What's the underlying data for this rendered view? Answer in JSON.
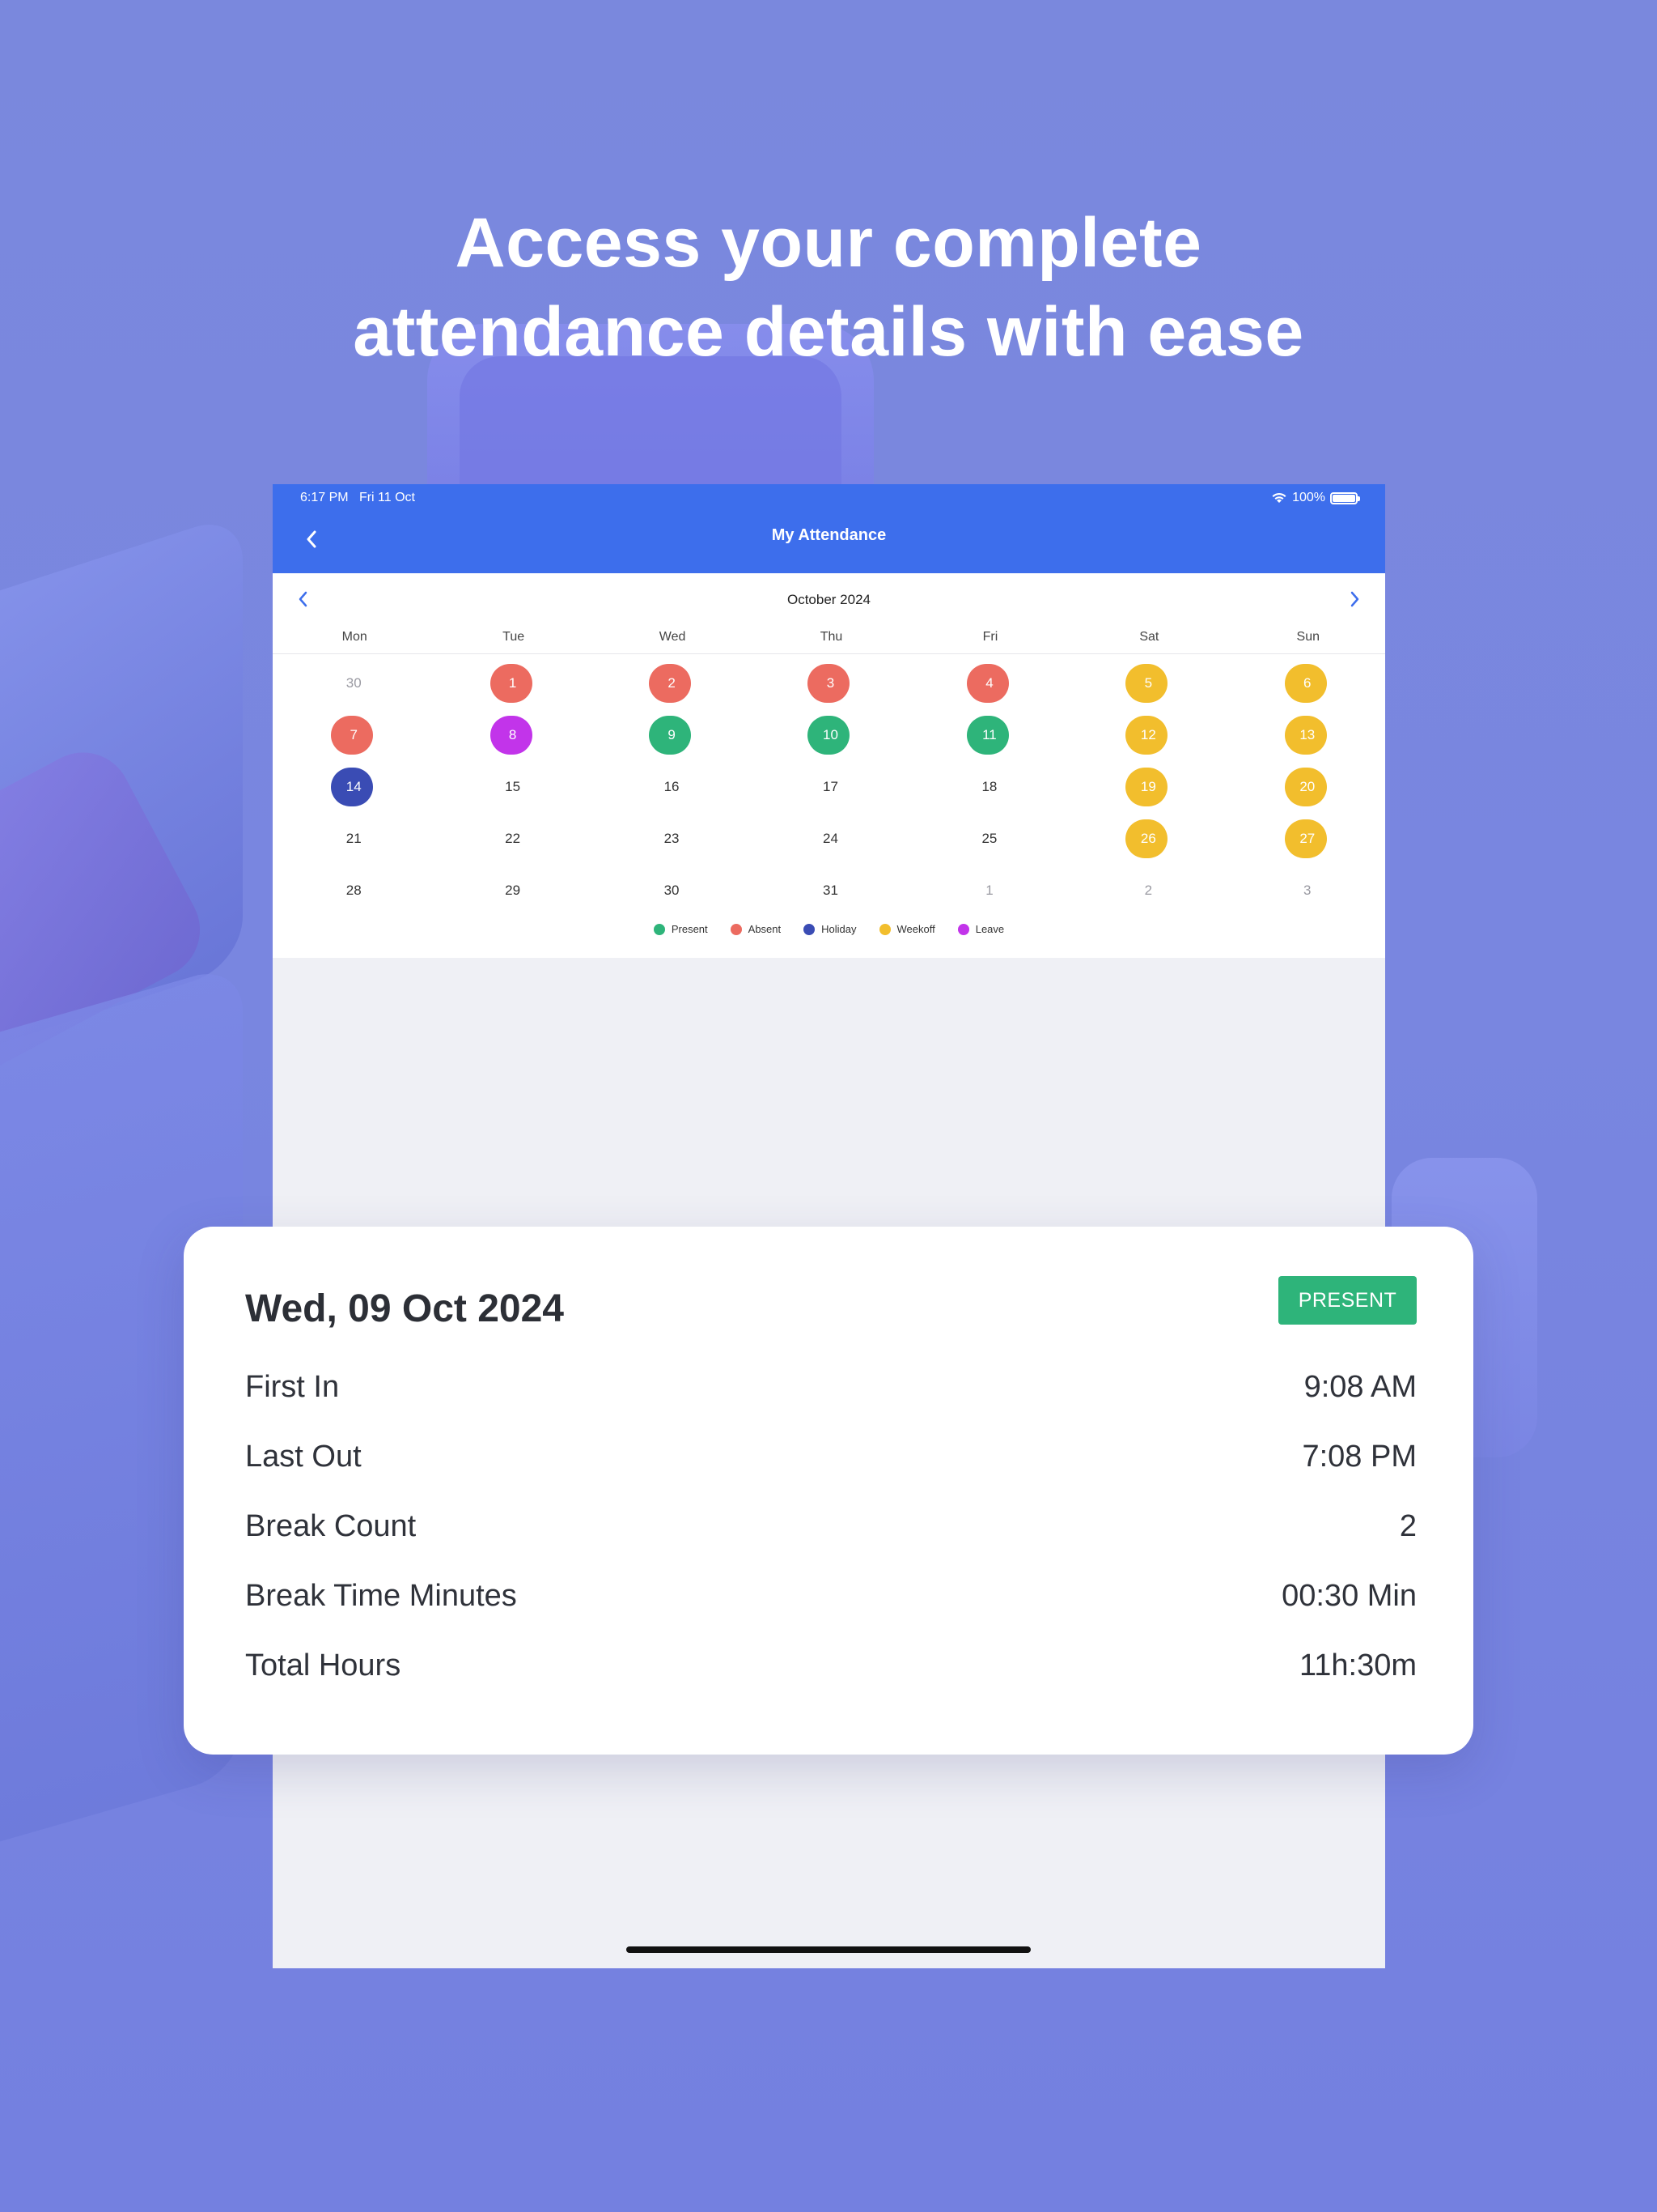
{
  "headline": {
    "line1": "Access your complete",
    "line2": "attendance details with ease"
  },
  "status_bar": {
    "time": "6:17 PM",
    "date": "Fri 11 Oct",
    "battery": "100%"
  },
  "nav": {
    "title": "My Attendance",
    "back_icon": "chevron-left-icon"
  },
  "calendar": {
    "month": "October 2024",
    "weekdays": [
      "Mon",
      "Tue",
      "Wed",
      "Thu",
      "Fri",
      "Sat",
      "Sun"
    ],
    "days": [
      {
        "label": "30",
        "status": "outside"
      },
      {
        "label": "1",
        "status": "absent"
      },
      {
        "label": "2",
        "status": "absent"
      },
      {
        "label": "3",
        "status": "absent"
      },
      {
        "label": "4",
        "status": "absent"
      },
      {
        "label": "5",
        "status": "weekoff"
      },
      {
        "label": "6",
        "status": "weekoff"
      },
      {
        "label": "7",
        "status": "absent"
      },
      {
        "label": "8",
        "status": "leave"
      },
      {
        "label": "9",
        "status": "present"
      },
      {
        "label": "10",
        "status": "present"
      },
      {
        "label": "11",
        "status": "present"
      },
      {
        "label": "12",
        "status": "weekoff"
      },
      {
        "label": "13",
        "status": "weekoff"
      },
      {
        "label": "14",
        "status": "holiday"
      },
      {
        "label": "15",
        "status": "none"
      },
      {
        "label": "16",
        "status": "none"
      },
      {
        "label": "17",
        "status": "none"
      },
      {
        "label": "18",
        "status": "none"
      },
      {
        "label": "19",
        "status": "weekoff"
      },
      {
        "label": "20",
        "status": "weekoff"
      },
      {
        "label": "21",
        "status": "none"
      },
      {
        "label": "22",
        "status": "none"
      },
      {
        "label": "23",
        "status": "none"
      },
      {
        "label": "24",
        "status": "none"
      },
      {
        "label": "25",
        "status": "none"
      },
      {
        "label": "26",
        "status": "weekoff"
      },
      {
        "label": "27",
        "status": "weekoff"
      },
      {
        "label": "28",
        "status": "none"
      },
      {
        "label": "29",
        "status": "none"
      },
      {
        "label": "30",
        "status": "none"
      },
      {
        "label": "31",
        "status": "none"
      },
      {
        "label": "1",
        "status": "outside"
      },
      {
        "label": "2",
        "status": "outside"
      },
      {
        "label": "3",
        "status": "outside"
      }
    ],
    "legend": [
      {
        "label": "Present",
        "key": "present"
      },
      {
        "label": "Absent",
        "key": "absent"
      },
      {
        "label": "Holiday",
        "key": "holiday"
      },
      {
        "label": "Weekoff",
        "key": "weekoff"
      },
      {
        "label": "Leave",
        "key": "leave"
      }
    ],
    "colors": {
      "present": "#2eb47a",
      "absent": "#ec6b60",
      "holiday": "#3a4cb4",
      "weekoff": "#f2be2d",
      "leave": "#c234ea"
    }
  },
  "detail": {
    "date": "Wed, 09 Oct 2024",
    "status": "PRESENT",
    "rows": [
      {
        "label": "First In",
        "value": "9:08 AM"
      },
      {
        "label": "Last Out",
        "value": "7:08 PM"
      },
      {
        "label": "Break Count",
        "value": "2"
      },
      {
        "label": "Break Time Minutes",
        "value": "00:30 Min"
      },
      {
        "label": "Total Hours",
        "value": "11h:30m"
      }
    ]
  },
  "theme": {
    "background": "#7a88dd",
    "nav_blue": "#3d6eec"
  }
}
